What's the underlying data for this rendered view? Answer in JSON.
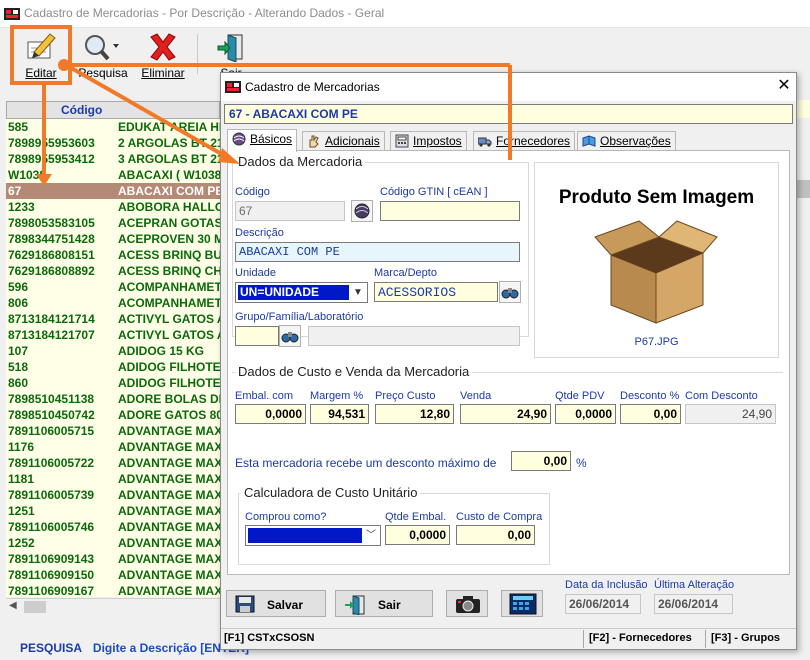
{
  "main_window": {
    "title": "Cadastro de Mercadorias - Por Descrição - Alterando Dados - Geral",
    "toolbar": {
      "editar": "Editar",
      "pesquisa": "Pesquisa",
      "eliminar": "Eliminar",
      "sair": "Sair"
    },
    "list": {
      "header_codigo": "Código",
      "rows": [
        {
          "codigo": "585",
          "descricao": "EDUKAT AREIA HI"
        },
        {
          "codigo": "7898955953603",
          "descricao": "2 ARGOLAS BT 21"
        },
        {
          "codigo": "7898955953412",
          "descricao": "3 ARGOLAS BT 21"
        },
        {
          "codigo": "W1038",
          "descricao": "ABACAXI ( W1038"
        },
        {
          "codigo": "67",
          "descricao": "ABACAXI COM PE"
        },
        {
          "codigo": "1233",
          "descricao": "ABOBORA HALLO"
        },
        {
          "codigo": "7898053583105",
          "descricao": "ACEPRAN GOTAS"
        },
        {
          "codigo": "7898344751428",
          "descricao": "ACEPROVEN 30 M"
        },
        {
          "codigo": "7629186808151",
          "descricao": "ACESS BRINQ BUI"
        },
        {
          "codigo": "7629186808892",
          "descricao": "ACESS BRINQ CHA"
        },
        {
          "codigo": "596",
          "descricao": "ACOMPANHAMET"
        },
        {
          "codigo": "806",
          "descricao": "ACOMPANHAMET"
        },
        {
          "codigo": "8713184121714",
          "descricao": "ACTIVYL GATOS A"
        },
        {
          "codigo": "8713184121707",
          "descricao": "ACTIVYL GATOS A"
        },
        {
          "codigo": "107",
          "descricao": "ADIDOG 15 KG"
        },
        {
          "codigo": "518",
          "descricao": "ADIDOG FILHOTE"
        },
        {
          "codigo": "860",
          "descricao": "ADIDOG FILHOTE"
        },
        {
          "codigo": "7898510451138",
          "descricao": "ADORE BOLAS DE"
        },
        {
          "codigo": "7898510450742",
          "descricao": "ADORE GATOS 80"
        },
        {
          "codigo": "7891106005715",
          "descricao": "ADVANTAGE MAX"
        },
        {
          "codigo": "1176",
          "descricao": "ADVANTAGE MAX"
        },
        {
          "codigo": "7891106005722",
          "descricao": "ADVANTAGE MAX"
        },
        {
          "codigo": "1181",
          "descricao": "ADVANTAGE MAX"
        },
        {
          "codigo": "7891106005739",
          "descricao": "ADVANTAGE MAX"
        },
        {
          "codigo": "1251",
          "descricao": "ADVANTAGE MAX"
        },
        {
          "codigo": "7891106005746",
          "descricao": "ADVANTAGE MAX"
        },
        {
          "codigo": "1252",
          "descricao": "ADVANTAGE MAX"
        },
        {
          "codigo": "7891106909143",
          "descricao": "ADVANTAGE MAX"
        },
        {
          "codigo": "7891106909150",
          "descricao": "ADVANTAGE MAX"
        },
        {
          "codigo": "7891106909167",
          "descricao": "ADVANTAGE MAX"
        }
      ]
    },
    "pesquisa_label": "PESQUISA",
    "pesquisa_hint": "Digite a Descrição [ENTER]"
  },
  "dialog": {
    "title": "Cadastro de Mercadorias",
    "product_header": "67 - ABACAXI COM PE",
    "tabs": [
      {
        "label": "Básicos",
        "icon": "yarn-ball-icon"
      },
      {
        "label": "Adicionais",
        "icon": "hand-icon"
      },
      {
        "label": "Impostos",
        "icon": "calculator-icon"
      },
      {
        "label": "Fornecedores",
        "icon": "truck-icon"
      },
      {
        "label": "Observações",
        "icon": "book-icon"
      }
    ],
    "dados": {
      "group_title": "Dados da Mercadoria",
      "codigo_label": "Código",
      "codigo_value": "67",
      "gtin_label": "Código GTIN [ cEAN ]",
      "gtin_value": "",
      "descricao_label": "Descrição",
      "descricao_value": "ABACAXI COM PE",
      "unidade_label": "Unidade",
      "unidade_value": "UN=UNIDADE",
      "marca_label": "Marca/Depto",
      "marca_value": "ACESSORIOS",
      "grupo_label": "Grupo/Família/Laboratório",
      "grupo_value": ""
    },
    "image": {
      "title": "Produto Sem Imagem",
      "filename": "P67.JPG"
    },
    "custo": {
      "group_title": "Dados de Custo e Venda da Mercadoria",
      "embal_label": "Embal. com",
      "embal_value": "0,0000",
      "margem_label": "Margem %",
      "margem_value": "94,531",
      "preco_custo_label": "Preço Custo",
      "preco_custo_value": "12,80",
      "venda_label": "Venda",
      "venda_value": "24,90",
      "qtde_pdv_label": "Qtde PDV",
      "qtde_pdv_value": "0,0000",
      "desconto_label": "Desconto %",
      "desconto_value": "0,00",
      "com_desconto_label": "Com Desconto",
      "com_desconto_value": "24,90"
    },
    "desconto_maximo": {
      "text": "Esta mercadoria recebe um desconto máximo de",
      "value": "0,00",
      "suffix": "%"
    },
    "calculadora": {
      "group_title": "Calculadora de Custo Unitário",
      "comprou_label": "Comprou como?",
      "comprou_value": "",
      "qtde_embal_label": "Qtde Embal.",
      "qtde_embal_value": "0,0000",
      "custo_compra_label": "Custo de Compra",
      "custo_compra_value": "0,00"
    },
    "buttons": {
      "salvar": "Salvar",
      "sair": "Sair"
    },
    "datas": {
      "inclusao_label": "Data da Inclusão",
      "inclusao_value": "26/06/2014",
      "alteracao_label": "Última Alteração",
      "alteracao_value": "26/06/2014"
    },
    "status": {
      "f1": "[F1] CSTxCSOSN",
      "f2": "[F2] - Fornecedores",
      "f3": "[F3] - Grupos"
    }
  },
  "colors": {
    "accent_orange": "#f07a28",
    "label_blue": "#1a3aa8",
    "list_green": "#0a6a0a",
    "field_yellow": "#ffffe0",
    "selection_blue": "#0018c8"
  }
}
